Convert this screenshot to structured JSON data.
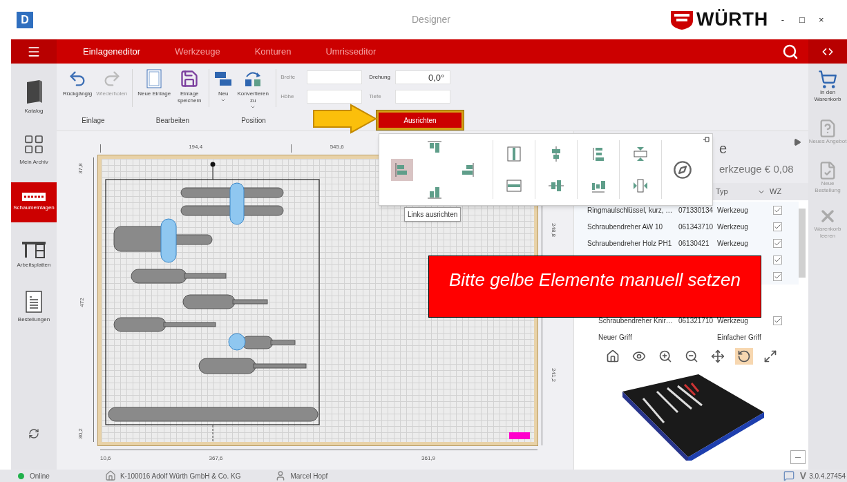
{
  "title_bar": {
    "logo_letter": "D",
    "title": "Designer",
    "brand": "WÜRTH",
    "controls": [
      "-",
      "□",
      "×"
    ]
  },
  "nav": {
    "tabs": [
      {
        "label": "Einlageneditor",
        "selected": true
      },
      {
        "label": "Werkzeuge",
        "selected": false
      },
      {
        "label": "Konturen",
        "selected": false
      },
      {
        "label": "Umrisseditor",
        "selected": false
      }
    ]
  },
  "sidebar": {
    "items": [
      {
        "label": "Katalog",
        "selected": false
      },
      {
        "label": "Mein Archiv",
        "selected": false
      },
      {
        "label": "Schaumeinlagen",
        "selected": true
      },
      {
        "label": "Arbeitsplatten",
        "selected": false
      },
      {
        "label": "Bestellungen",
        "selected": false
      }
    ]
  },
  "toolbar": {
    "buttons": [
      {
        "label": "Rückgängig",
        "disabled": false,
        "dropdown": false
      },
      {
        "label": "Wiederholen",
        "disabled": true,
        "dropdown": false
      },
      {
        "label": "Neue Einlage",
        "disabled": false,
        "dropdown": false
      },
      {
        "label": "Einlage speichern",
        "disabled": false,
        "dropdown": false
      },
      {
        "label": "Neu",
        "disabled": false,
        "dropdown": true
      },
      {
        "label": "Konvertieren zu",
        "disabled": false,
        "dropdown": true
      }
    ],
    "fields": [
      {
        "label": "Breite",
        "disabled": true
      },
      {
        "label": "Höhe",
        "disabled": true
      },
      {
        "label": "Drehung",
        "value": "0,0°",
        "disabled": false
      },
      {
        "label": "Tiefe",
        "disabled": true
      }
    ],
    "groups": [
      "Einlage",
      "Bearbeiten",
      "Position"
    ],
    "align_button": {
      "label": "Ausrichten",
      "highlighted": true
    }
  },
  "align_popup": {
    "tooltip": "Links ausrichten",
    "buttons": [
      {
        "selected": true
      },
      {
        "selected": false
      },
      {
        "selected": false
      },
      {
        "selected": false
      },
      {
        "selected": false
      },
      {
        "selected": false
      },
      {
        "selected": false
      },
      {
        "selected": false
      },
      {
        "selected": false
      },
      {
        "selected": false
      },
      {
        "selected": false
      },
      {
        "selected": false
      },
      {
        "selected": false
      }
    ]
  },
  "canvas": {
    "top_ruler": [
      "194,4",
      "545,6"
    ],
    "left_ruler": [
      "37,8",
      "472",
      "30,2"
    ],
    "right_ruler": [
      "248,8",
      "241,2"
    ],
    "bottom_ruler": [
      "10,6",
      "367,6",
      "361,9"
    ]
  },
  "panel": {
    "title": "e",
    "subtitle": "erkzeuge € 0,08",
    "columns": [
      "Typ",
      "WZ"
    ],
    "rows": [
      {
        "name": "Ringmaulschlüssel, kurz, …",
        "number": "071330134",
        "type": "Werkzeug",
        "checked": true
      },
      {
        "name": "Schraubendreher AW 10",
        "number": "061343710",
        "type": "Werkzeug",
        "checked": true
      },
      {
        "name": "Schraubendreher Holz PH1",
        "number": "06130421",
        "type": "Werkzeug",
        "checked": true
      },
      {
        "checked": true
      },
      {
        "checked": true
      },
      {
        "children": [
          {
            "name": "Schraubendreher Knir…",
            "number": "061321710",
            "type": "Werkzeug",
            "checked": true
          },
          {
            "name": "Neuer Griff",
            "type": "Einfacher Griff"
          }
        ]
      }
    ],
    "viewer_tools": [
      {
        "selected": false
      },
      {
        "selected": false
      },
      {
        "selected": false
      },
      {
        "selected": false
      },
      {
        "selected": false
      },
      {
        "selected": true
      },
      {
        "selected": false
      }
    ]
  },
  "right_sidebar": {
    "items": [
      {
        "label": "In den Warenkorb",
        "disabled": false
      },
      {
        "label": "Neues Angebot",
        "disabled": true
      },
      {
        "label": "Neue Bestellung",
        "disabled": true
      },
      {
        "label": "Warenkorb leeren",
        "disabled": true
      }
    ]
  },
  "banner": {
    "text": "Bitte gelbe Elemente manuell setzen"
  },
  "status_bar": {
    "status": "Online",
    "online": true,
    "company": "K-100016 Adolf Würth GmbH & Co. KG",
    "user": "Marcel Hopf",
    "version_logo": "V",
    "version": "3.0.4.27454"
  }
}
